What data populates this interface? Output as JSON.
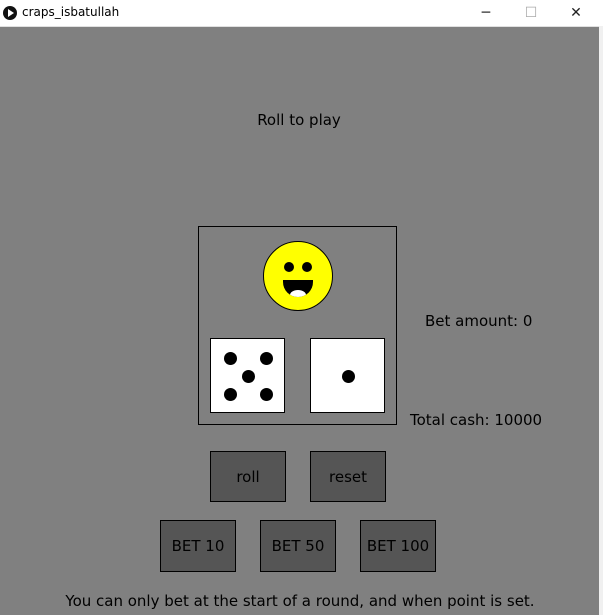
{
  "window": {
    "title": "craps_isbatullah",
    "minimize_glyph": "─",
    "maximize_glyph": "☐",
    "close_glyph": "✕"
  },
  "game": {
    "status": "Roll to play",
    "bet_amount_label": "Bet amount:  0",
    "total_cash_label": "Total cash:  10000",
    "die1_value": 5,
    "die2_value": 1,
    "mood": "happy-smiley"
  },
  "buttons": {
    "roll": "roll",
    "reset": "reset",
    "bet10": "BET 10",
    "bet50": "BET 50",
    "bet100": "BET 100"
  },
  "footer": {
    "message": "You can only bet at the start of a round, and when point is set."
  },
  "colors": {
    "background": "#808080",
    "button": "#555555",
    "smiley": "#ffff00"
  }
}
